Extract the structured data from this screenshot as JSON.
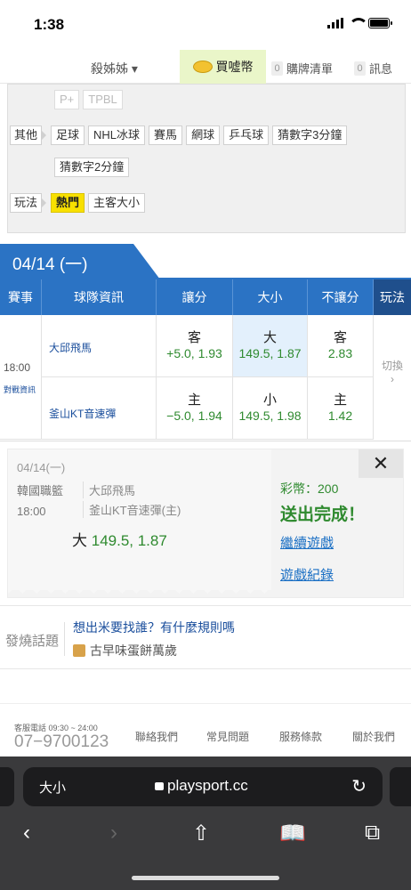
{
  "status": {
    "time": "1:38"
  },
  "topnav": {
    "user": "殺姊姊 ▾",
    "buy": "買噓幣",
    "cart_count": "0",
    "cart": "購牌清單",
    "msg_count": "0",
    "msg": "訊息"
  },
  "filter": {
    "row0": [
      "P+",
      "TPBL"
    ],
    "other_label": "其他",
    "other": [
      "足球",
      "NHL冰球",
      "賽馬",
      "網球",
      "乒乓球",
      "猜數字3分鐘"
    ],
    "other2": [
      "猜數字2分鐘"
    ],
    "play_label": "玩法",
    "play": [
      "熱門",
      "主客大小"
    ]
  },
  "date_tab": "04/14 (一)",
  "table": {
    "headers": [
      "賽事",
      "球隊資訊",
      "讓分",
      "大小",
      "不讓分",
      "玩法"
    ],
    "time": "18:00",
    "vs_link": "對戰資訊",
    "team_away": "大邱飛馬",
    "team_home": "釜山KT音速彈",
    "away": {
      "spread_t": "客",
      "spread_v": "+5.0, 1.93",
      "total_t": "大",
      "total_v": "149.5, 1.87",
      "ml_t": "客",
      "ml_v": "2.83"
    },
    "home": {
      "spread_t": "主",
      "spread_v": "−5.0, 1.94",
      "total_t": "小",
      "total_v": "149.5, 1.98",
      "ml_t": "主",
      "ml_v": "1.42"
    },
    "switch": "切換",
    "switch_arrow": "›"
  },
  "receipt": {
    "date": "04/14(一)",
    "league": "韓國職籃",
    "time": "18:00",
    "team1": "大邱飛馬",
    "team2": "釜山KT音速彈(主)",
    "pick_label": "大",
    "pick_value": "149.5, 1.87",
    "coins": "彩幣：200",
    "done": "送出完成！",
    "continue": "繼續遊戲",
    "history": "遊戲紀錄",
    "close": "✕"
  },
  "hot": {
    "label": "發燒話題",
    "question": "想出米要找誰？有什麼規則嗎",
    "sub": "古早味蛋餅萬歲"
  },
  "footer": {
    "tel_label": "客服電話 09:30 ~ 24:00",
    "tel": "07−9700123",
    "links": [
      "聯絡我們",
      "常見問題",
      "服務條款",
      "關於我們"
    ]
  },
  "browser": {
    "aa": "大小",
    "url": "playsport.cc",
    "reload": "↻",
    "back": "‹",
    "forward": "›",
    "share": "⇧",
    "bookmarks": "📖",
    "tabs": "⧉"
  }
}
